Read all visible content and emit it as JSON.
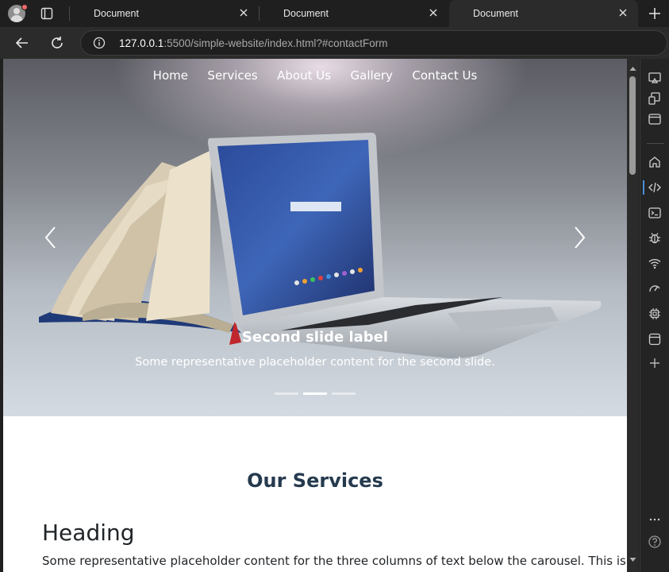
{
  "browser": {
    "tabs": [
      {
        "title": "Document",
        "active": false
      },
      {
        "title": "Document",
        "active": false
      },
      {
        "title": "Document",
        "active": true
      }
    ],
    "url_host": "127.0.0.1",
    "url_rest": ":5500/simple-website/index.html?#contactForm"
  },
  "site": {
    "nav": [
      "Home",
      "Services",
      "About Us",
      "Gallery",
      "Contact Us"
    ],
    "carousel": {
      "caption_title": "Second slide label",
      "caption_text": "Some representative placeholder content for the second slide.",
      "slide_count": 3,
      "active_slide": 2
    },
    "services_title": "Our Services",
    "column": {
      "heading": "Heading",
      "text": "Some representative placeholder content for the three columns of text below the carousel. This is"
    }
  },
  "sidepanel_icons": [
    "cast-icon",
    "device-emulation-icon",
    "window-icon",
    "home-icon",
    "code-icon",
    "console-icon",
    "bug-icon",
    "wifi-icon",
    "performance-icon",
    "memory-chip-icon",
    "application-icon",
    "add-icon",
    "more-icon",
    "help-icon"
  ],
  "colors": {
    "heading": "#253a4e",
    "accent": "#4c8fd6"
  }
}
